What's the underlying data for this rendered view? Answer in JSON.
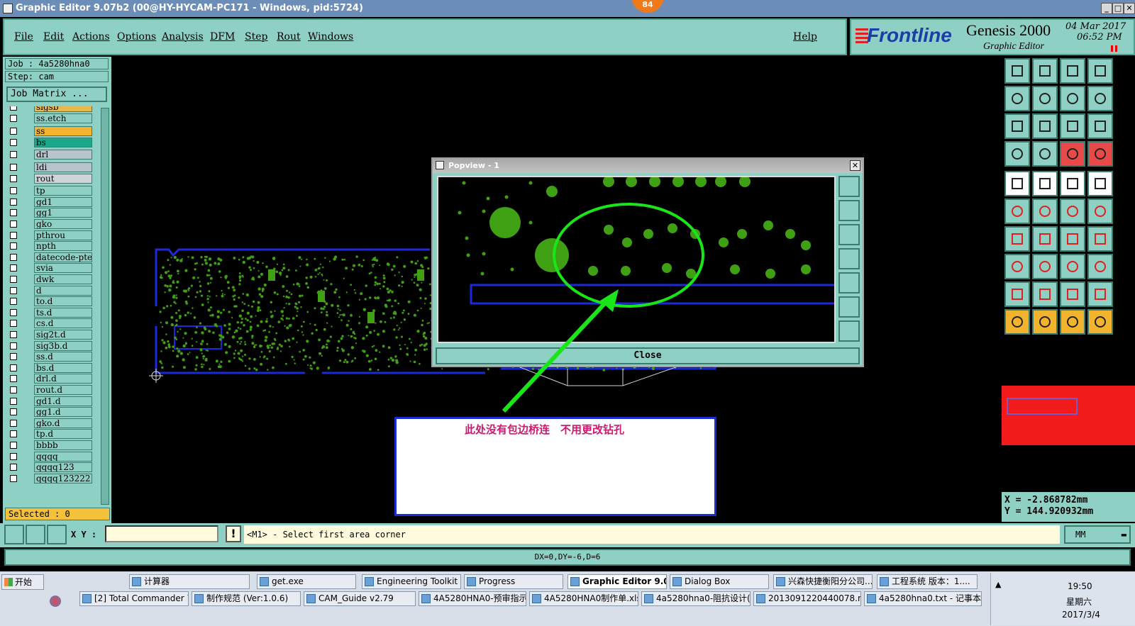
{
  "window": {
    "title": "Graphic Editor 9.07b2 (00@HY-HYCAM-PC171 - Windows, pid:5724)",
    "badge": "84"
  },
  "menu": {
    "items": [
      "File",
      "Edit",
      "Actions",
      "Options",
      "Analysis",
      "DFM",
      "Step",
      "Rout",
      "Windows"
    ],
    "help": "Help"
  },
  "brand": {
    "logo": "Frontline",
    "product": "Genesis 2000",
    "subtitle": "Graphic Editor",
    "date": "04 Mar 2017",
    "time": "06:52 PM"
  },
  "left": {
    "job": "Job : 4a5280hna0",
    "step": "Step: cam",
    "job_matrix": "Job Matrix ...",
    "selected": "Selected : 0",
    "layers": [
      {
        "name": "sigsb",
        "color": "#e8b94a"
      },
      {
        "name": "ss.etch",
        "color": "#8fd0c4"
      },
      {
        "name": "ss",
        "color": "#f2b32e"
      },
      {
        "name": "bs",
        "color": "#1aa88a"
      },
      {
        "name": "drl",
        "color": "#b8c4cc"
      },
      {
        "name": "ldi",
        "color": "#b8c4cc"
      },
      {
        "name": "rout",
        "color": "#d0d4d8"
      },
      {
        "name": "tp",
        "color": "#8fd0c4"
      },
      {
        "name": "gd1",
        "color": "#8fd0c4"
      },
      {
        "name": "gg1",
        "color": "#8fd0c4"
      },
      {
        "name": "gko",
        "color": "#8fd0c4"
      },
      {
        "name": "pthrou",
        "color": "#8fd0c4"
      },
      {
        "name": "npth",
        "color": "#8fd0c4"
      },
      {
        "name": "datecode-pte",
        "color": "#8fd0c4"
      },
      {
        "name": "svia",
        "color": "#8fd0c4"
      },
      {
        "name": "dwk",
        "color": "#8fd0c4"
      },
      {
        "name": "d",
        "color": "#8fd0c4"
      },
      {
        "name": "to.d",
        "color": "#8fd0c4"
      },
      {
        "name": "ts.d",
        "color": "#8fd0c4"
      },
      {
        "name": "cs.d",
        "color": "#8fd0c4"
      },
      {
        "name": "sig2t.d",
        "color": "#8fd0c4"
      },
      {
        "name": "sig3b.d",
        "color": "#8fd0c4"
      },
      {
        "name": "ss.d",
        "color": "#8fd0c4"
      },
      {
        "name": "bs.d",
        "color": "#8fd0c4"
      },
      {
        "name": "drl.d",
        "color": "#8fd0c4"
      },
      {
        "name": "rout.d",
        "color": "#8fd0c4"
      },
      {
        "name": "gd1.d",
        "color": "#8fd0c4"
      },
      {
        "name": "gg1.d",
        "color": "#8fd0c4"
      },
      {
        "name": "gko.d",
        "color": "#8fd0c4"
      },
      {
        "name": "tp.d",
        "color": "#8fd0c4"
      },
      {
        "name": "bbbb",
        "color": "#8fd0c4"
      },
      {
        "name": "qqqq",
        "color": "#8fd0c4"
      },
      {
        "name": "qqqq123",
        "color": "#8fd0c4"
      },
      {
        "name": "qqqq123222",
        "color": "#8fd0c4"
      }
    ]
  },
  "popview": {
    "title": "Popview - 1",
    "close": "Close"
  },
  "annotation": {
    "text": "此处没有包边桥连　不用更改钻孔"
  },
  "coords": {
    "x": "X = -2.868782mm",
    "y": "Y = 144.920932mm"
  },
  "bottom": {
    "xy_label": "X Y :",
    "xy_value": "",
    "prompt": "<M1> - Select first area corner",
    "units": "MM",
    "status": "DX=0,DY=-6,D=6"
  },
  "taskbar": {
    "start": "开始",
    "row1": [
      "计算器",
      "get.exe",
      "Engineering Toolkit 9....",
      "Progress",
      "Graphic Editor 9.07...",
      "Dialog Box",
      "兴森快捷衡阳分公司...",
      "工程系统  版本：1...."
    ],
    "row2": [
      "[2] Total Commander 7.0...",
      "制作规范 (Ver:1.0.6)",
      "CAM_Guide v2.79",
      "4A5280HNA0-预审指示....",
      "4A5280HNA0制作单.xls ...",
      "4a5280hna0-阻抗设计(...",
      "2013091220440078.rtf [...",
      "4a5280hna0.txt - 记事本"
    ],
    "clock": "19:50",
    "weekday": "星期六",
    "date": "2017/3/4"
  },
  "colors": {
    "panel": "#8fd0c4",
    "pad_green": "#3ea012",
    "outline_blue": "#1b2ad8",
    "annot_green": "#19e619",
    "annot_text": "#d01870"
  }
}
